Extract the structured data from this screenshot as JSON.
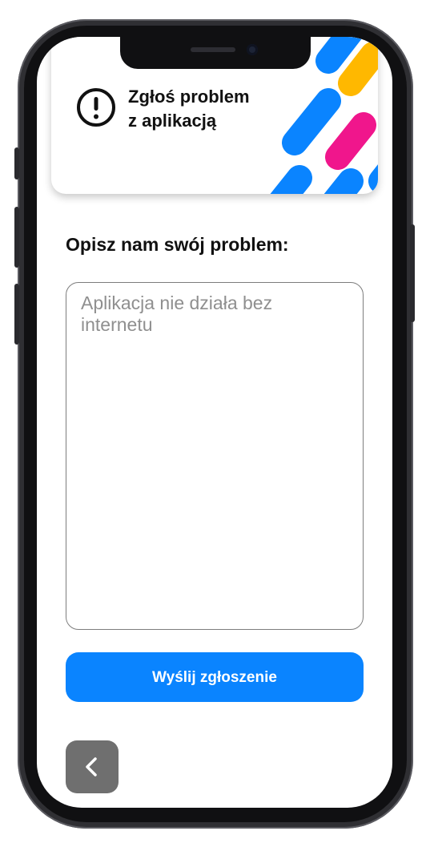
{
  "header": {
    "title": "Zgłoś problem\nz aplikacją",
    "icon": "alert-circle-icon"
  },
  "form": {
    "section_title": "Opisz nam swój problem:",
    "description_placeholder": "Aplikacja nie działa bez internetu",
    "description_value": "",
    "submit_label": "Wyślij zgłoszenie"
  },
  "navigation": {
    "back_icon": "chevron-left-icon"
  },
  "colors": {
    "accent": "#0A84FF",
    "stripe_blue": "#0A84FF",
    "stripe_pink": "#F0168C",
    "stripe_yellow": "#FFB800",
    "back_button": "#6F6F6F"
  }
}
